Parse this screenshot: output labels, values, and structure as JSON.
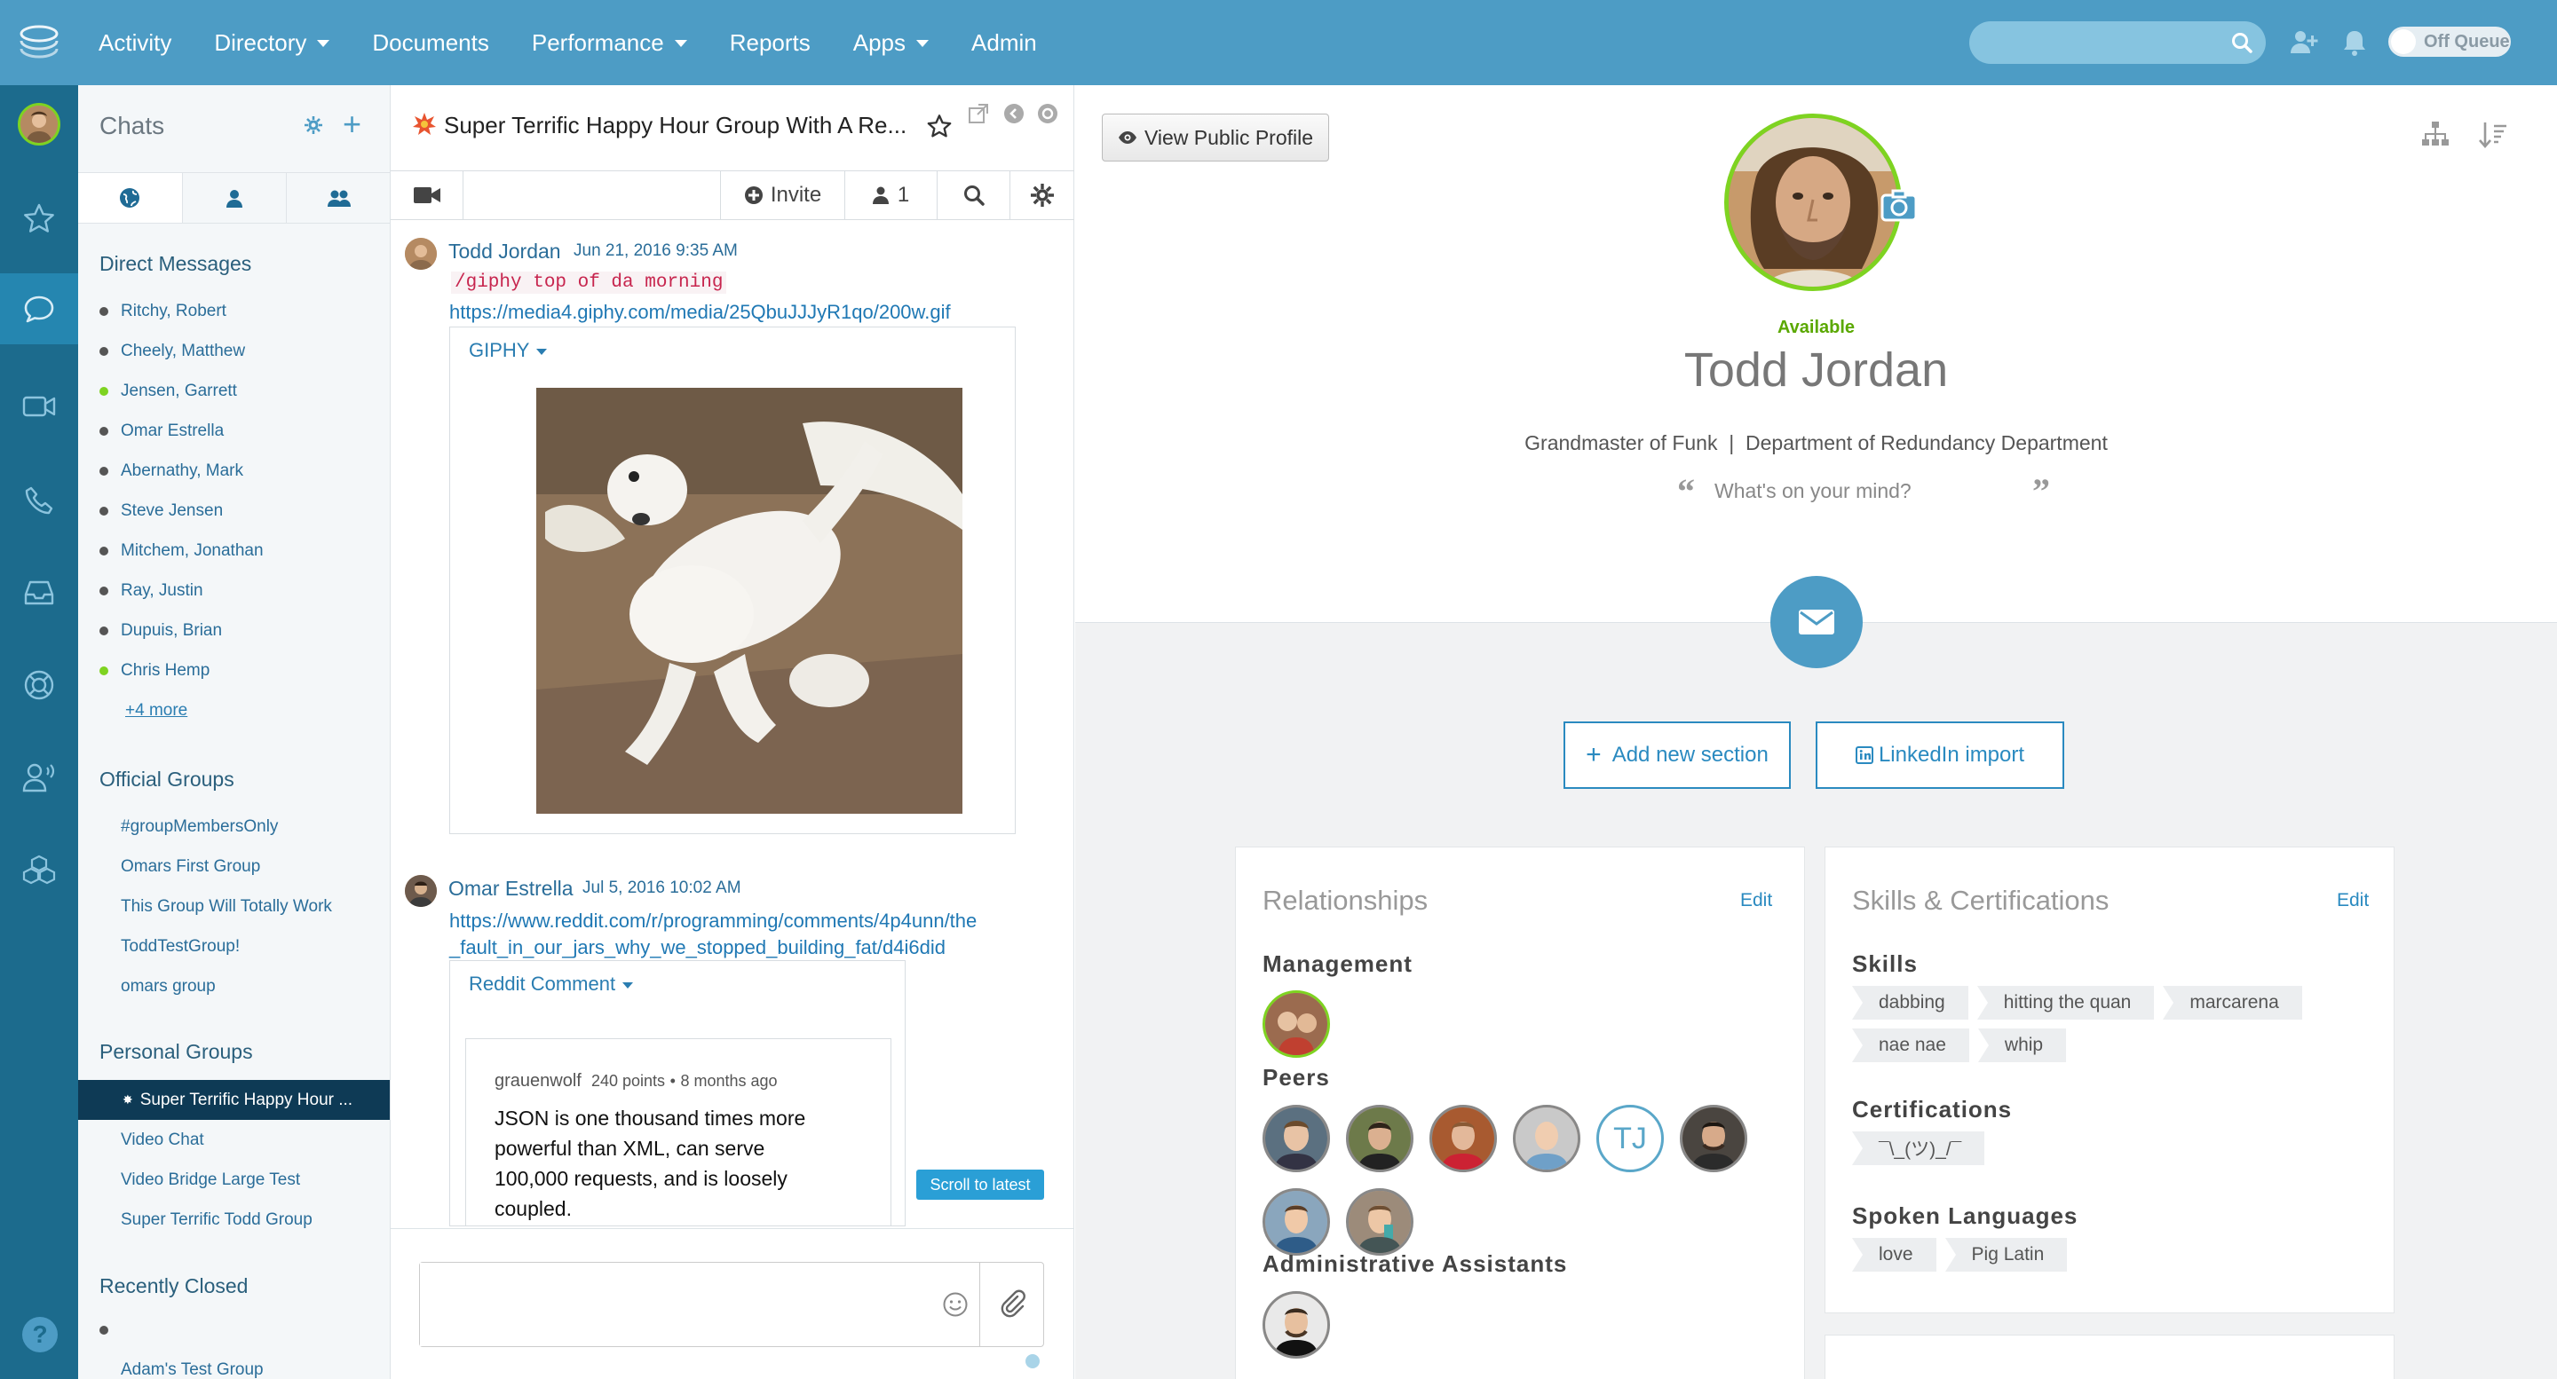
{
  "topnav": {
    "items": [
      {
        "label": "Activity",
        "dropdown": false
      },
      {
        "label": "Directory",
        "dropdown": true
      },
      {
        "label": "Documents",
        "dropdown": false
      },
      {
        "label": "Performance",
        "dropdown": true
      },
      {
        "label": "Reports",
        "dropdown": false
      },
      {
        "label": "Apps",
        "dropdown": true
      },
      {
        "label": "Admin",
        "dropdown": false
      }
    ],
    "search_placeholder": "",
    "queue_toggle": "Off Queue"
  },
  "sidebar_icons": [
    "avatar",
    "star-icon",
    "chat-bubble-icon",
    "video-icon",
    "phone-icon",
    "inbox-icon",
    "lifebuoy-icon",
    "agent-icon",
    "org-cubes-icon",
    "help-icon"
  ],
  "chats": {
    "title": "Chats",
    "tabs": [
      "globe-icon",
      "person-icon",
      "group-icon"
    ],
    "direct_messages": {
      "title": "Direct Messages",
      "items": [
        {
          "name": "Ritchy, Robert",
          "status": "offline"
        },
        {
          "name": "Cheely, Matthew",
          "status": "offline"
        },
        {
          "name": "Jensen, Garrett",
          "status": "online"
        },
        {
          "name": "Omar Estrella",
          "status": "offline"
        },
        {
          "name": "Abernathy, Mark",
          "status": "offline"
        },
        {
          "name": "Steve Jensen",
          "status": "offline"
        },
        {
          "name": "Mitchem, Jonathan",
          "status": "offline"
        },
        {
          "name": "Ray, Justin",
          "status": "offline"
        },
        {
          "name": "Dupuis, Brian",
          "status": "offline"
        },
        {
          "name": "Chris Hemp",
          "status": "online"
        }
      ],
      "more": "+4 more"
    },
    "official_groups": {
      "title": "Official Groups",
      "items": [
        "#groupMembersOnly",
        "Omars First Group",
        "This Group Will Totally Work",
        "ToddTestGroup!",
        "omars group"
      ]
    },
    "personal_groups": {
      "title": "Personal Groups",
      "items": [
        "Super Terrific Happy Hour ...",
        "Video Chat",
        "Video Bridge Large Test",
        "Super Terrific Todd Group"
      ],
      "active_index": 0
    },
    "recently_closed": {
      "title": "Recently Closed",
      "items": [
        "",
        "Adam's Test Group"
      ]
    }
  },
  "conversation": {
    "title": "Super Terrific Happy Hour Group With A Re...",
    "toolbar": {
      "invite": "Invite",
      "members": "1"
    },
    "messages": [
      {
        "author": "Todd Jordan",
        "time": "Jun 21, 2016 9:35 AM",
        "command": "/giphy top of da morning",
        "link": "https://media4.giphy.com/media/25QbuJJJyR1qo/200w.gif",
        "card_label": "GIPHY"
      },
      {
        "author": "Omar Estrella",
        "time": "Jul 5, 2016 10:02 AM",
        "link_line1": "https://www.reddit.com/r/programming/comments/4p4unn/the",
        "link_line2": "_fault_in_our_jars_why_we_stopped_building_fat/d4i6did",
        "card_label": "Reddit Comment",
        "comment": {
          "user": "grauenwolf",
          "points": "240 points",
          "bullet": "•",
          "age": "8 months ago",
          "lines": [
            "JSON is one thousand times more",
            "powerful than XML, can serve",
            "100,000 requests, and is loosely",
            "coupled."
          ]
        }
      }
    ],
    "scroll_latest": "Scroll to latest",
    "composer_placeholder": ""
  },
  "profile": {
    "view_public": "View Public Profile",
    "status": "Available",
    "name": "Todd Jordan",
    "title": "Grandmaster of Funk",
    "separator": "|",
    "department": "Department of Redundancy Department",
    "mind_placeholder": "What's on your mind?",
    "add_section": "Add new section",
    "linkedin": "LinkedIn import",
    "relationships": {
      "title": "Relationships",
      "edit": "Edit",
      "management_title": "Management",
      "peers_title": "Peers",
      "peers_initials": "TJ",
      "admin_title": "Administrative Assistants"
    },
    "skills_panel": {
      "title": "Skills & Certifications",
      "edit": "Edit",
      "skills_title": "Skills",
      "skills": [
        "dabbing",
        "hitting the quan",
        "marcarena",
        "nae nae",
        "whip"
      ],
      "certs_title": "Certifications",
      "certs": [
        "¯\\_(ツ)_/¯"
      ],
      "languages_title": "Spoken Languages",
      "languages": [
        "love",
        "Pig Latin"
      ]
    }
  },
  "colors": {
    "topbar": "#4d9cc5",
    "rail": "#1c6b8d",
    "online": "#7ed321",
    "link": "#2a6d99",
    "active_group": "#0e3a55"
  }
}
